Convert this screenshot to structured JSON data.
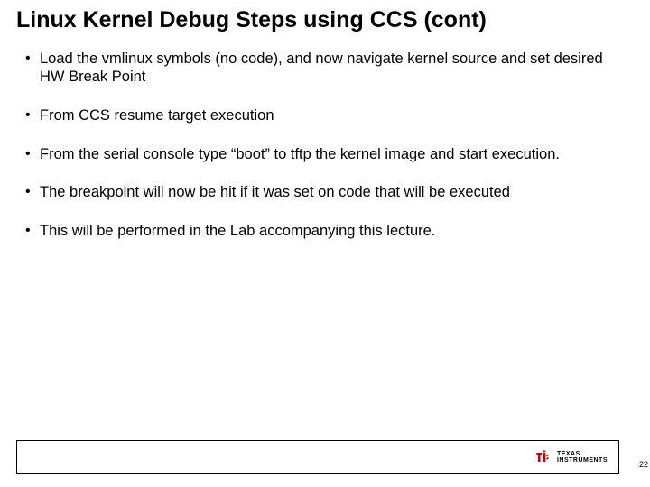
{
  "title": "Linux Kernel Debug Steps using CCS (cont)",
  "bullets": [
    "Load the vmlinux symbols (no code), and now navigate kernel source and set desired HW Break Point",
    "From CCS resume target execution",
    "From the serial console type “boot” to tftp the kernel image and start execution.",
    "The breakpoint will now be hit if it was set on code that will be executed",
    "This will be performed in the Lab accompanying this lecture."
  ],
  "footer": {
    "logo_line1": "TEXAS",
    "logo_line2": "INSTRUMENTS",
    "logo_color": "#cc0000"
  },
  "page_number": "22"
}
